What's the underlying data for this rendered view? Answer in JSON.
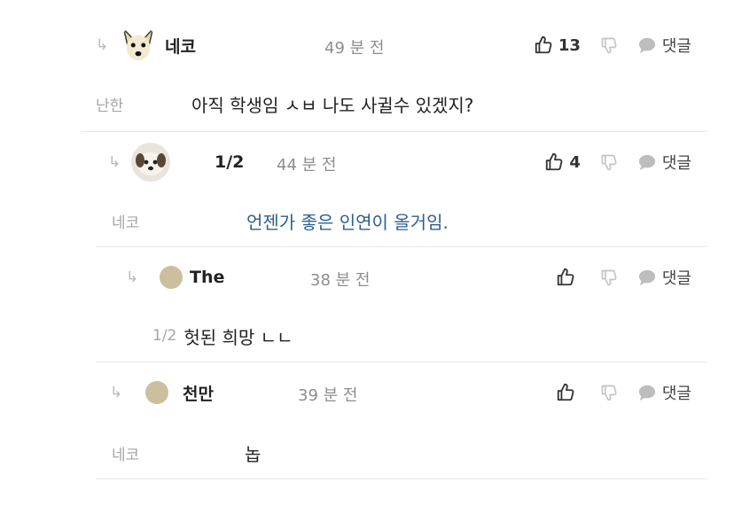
{
  "comments": [
    {
      "name": "네코",
      "time": "49 분 전",
      "likes": "13",
      "reply_label": "댓글",
      "quote": "난한",
      "text": "아직 학생임 ㅅㅂ 나도 사귈수 있겠지?",
      "avatar": "dog-face"
    },
    {
      "name": "1/2",
      "time": "44 분 전",
      "likes": "4",
      "reply_label": "댓글",
      "quote": "네코",
      "text": "언젠가 좋은 인연이 올거임.",
      "avatar": "puppy-photo",
      "text_color": "#2d5f8f"
    },
    {
      "name": "The",
      "time": "38 분 전",
      "likes": "",
      "reply_label": "댓글",
      "quote": "1/2",
      "text": "헛된 희망 ㄴㄴ",
      "avatar": "tan-circle"
    },
    {
      "name": "천만",
      "time": "39 분 전",
      "likes": "",
      "reply_label": "댓글",
      "quote": "네코",
      "text": "놉",
      "avatar": "tan-circle"
    }
  ],
  "icons": {
    "reply_indent": "reply-arrow-icon",
    "like": "thumbs-up-icon",
    "dislike": "thumbs-down-icon",
    "reply": "speech-bubble-icon"
  },
  "colors": {
    "reply_text": "#2d5f8f",
    "meta_gray": "#8d8d8d",
    "avatar_tan": "#cbbf9e"
  }
}
